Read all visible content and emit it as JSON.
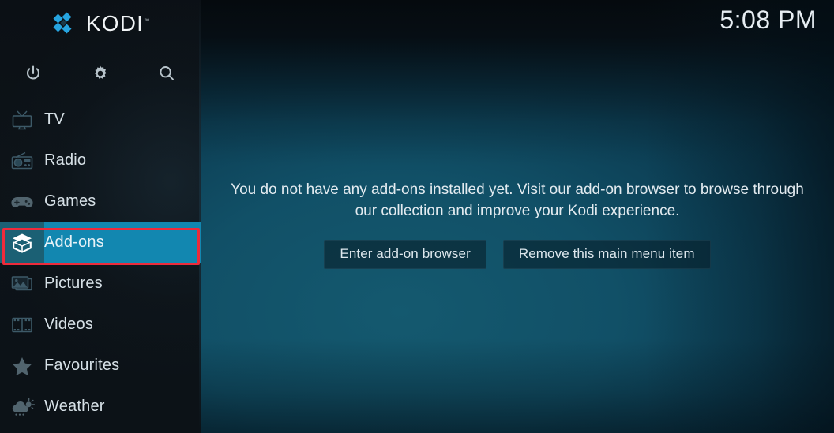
{
  "app": {
    "brand_name": "KODI",
    "brand_tm": "™",
    "logo_color": "#26a4e0",
    "accent_selected": "#1287b0",
    "accent_selected_icon": "#1b6074",
    "annotation_color": "#ee2b3b"
  },
  "clock": {
    "time": "5:08 PM"
  },
  "topbar": {
    "buttons": [
      {
        "name": "power-icon",
        "label": "Power"
      },
      {
        "name": "gear-icon",
        "label": "Settings"
      },
      {
        "name": "search-icon",
        "label": "Search"
      }
    ]
  },
  "sidebar": {
    "items": [
      {
        "label": "TV",
        "icon": "tv-icon",
        "selected": false
      },
      {
        "label": "Radio",
        "icon": "radio-icon",
        "selected": false
      },
      {
        "label": "Games",
        "icon": "gamepad-icon",
        "selected": false
      },
      {
        "label": "Add-ons",
        "icon": "addon-box-icon",
        "selected": true
      },
      {
        "label": "Pictures",
        "icon": "pictures-icon",
        "selected": false
      },
      {
        "label": "Videos",
        "icon": "film-strip-icon",
        "selected": false
      },
      {
        "label": "Favourites",
        "icon": "star-icon",
        "selected": false
      },
      {
        "label": "Weather",
        "icon": "weather-icon",
        "selected": false
      }
    ]
  },
  "main": {
    "empty_message": "You do not have any add-ons installed yet. Visit our add-on browser to browse through our collection and improve your Kodi experience.",
    "buttons": {
      "enter_browser": "Enter add-on browser",
      "remove_item": "Remove this main menu item"
    }
  }
}
